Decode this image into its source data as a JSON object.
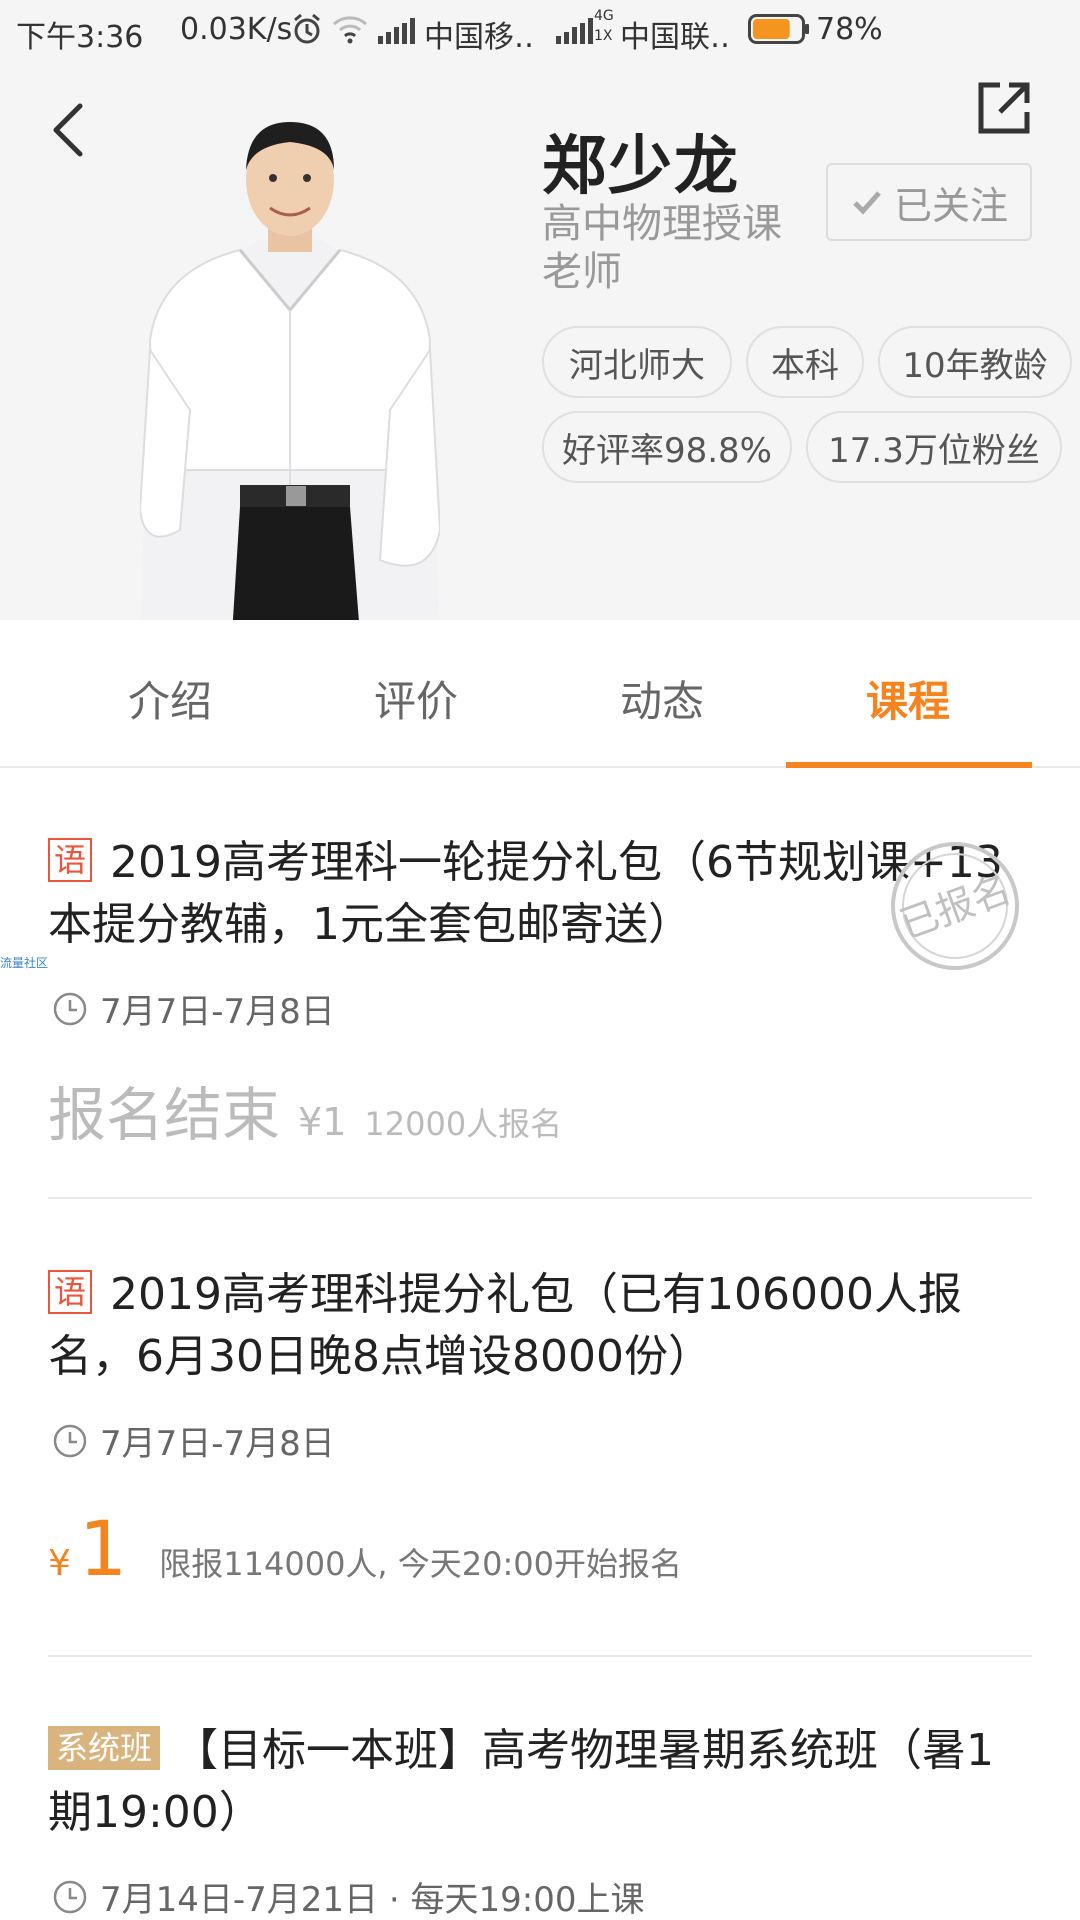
{
  "status_bar": {
    "time": "下午3:36",
    "net_speed": "0.03K/s",
    "carrier1": "中国移‥",
    "net_type_top": "4G",
    "net_type_bottom": "1X",
    "carrier2": "中国联‥",
    "battery": "78%",
    "battery_level": 0.78
  },
  "teacher": {
    "name": "郑少龙",
    "subject": "高中物理授课老师",
    "follow_label": "已关注",
    "tags": [
      "河北师大",
      "本科",
      "10年教龄",
      "好评率98.8%",
      "17.3万位粉丝"
    ]
  },
  "tabs": [
    "介绍",
    "评价",
    "动态",
    "课程"
  ],
  "active_tab": "课程",
  "courses": [
    {
      "badge": "语",
      "title": "2019高考理科一轮提分礼包（6节规划课+13本提分教辅，1元全套包邮寄送）",
      "date": "7月7日-7月8日",
      "status": "报名结束",
      "price": "¥1",
      "enrolled": "12000人报名",
      "stamp": "已报名"
    },
    {
      "badge": "语",
      "title": "2019高考理科提分礼包（已有106000人报名，6月30日晚8点增设8000份）",
      "date": "7月7日-7月8日",
      "price_symbol": "¥",
      "price_value": "1",
      "limit": "限报114000人, 今天20:00开始报名"
    },
    {
      "badge": "系统班",
      "title": "【目标一本班】高考物理暑期系统班（暑1期19:00）",
      "date": "7月14日-7月21日 · 每天19:00上课"
    }
  ],
  "watermark": "流量社区",
  "colors": {
    "accent": "#f5841f",
    "badge_red": "#e8563b",
    "badge_gold": "#d9b47e"
  }
}
